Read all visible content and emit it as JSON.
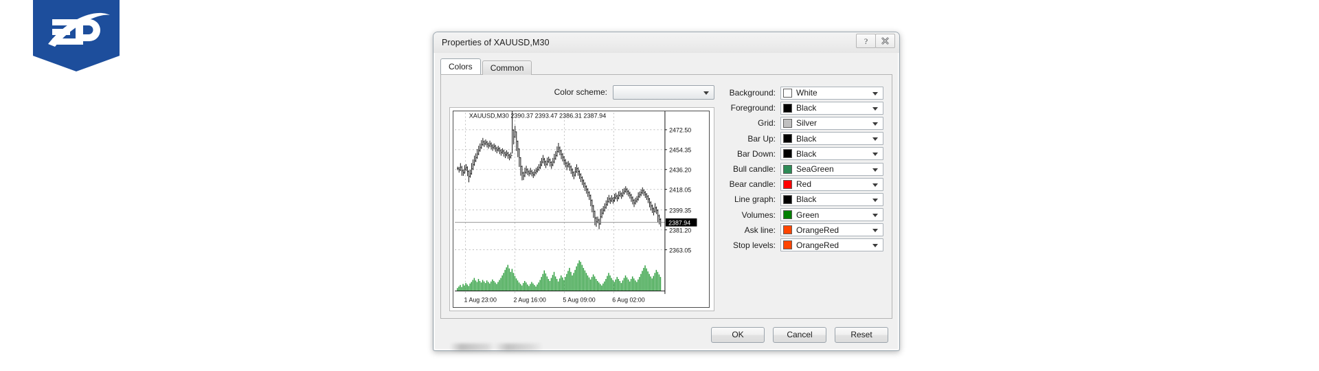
{
  "brand": {
    "name": "fp-logo",
    "text": "FP",
    "color": "#1d4e9c"
  },
  "dialog": {
    "title": "Properties of XAUUSD,M30",
    "title_buttons": [
      {
        "name": "help-button",
        "glyph": "?"
      },
      {
        "name": "close-button",
        "glyph": "✖"
      }
    ],
    "tabs": [
      {
        "label": "Colors",
        "active": true
      },
      {
        "label": "Common",
        "active": false
      }
    ],
    "scheme": {
      "label": "Color scheme:",
      "value": "",
      "placeholder": ""
    },
    "color_rows": [
      {
        "label": "Background:",
        "value": "White",
        "hex": "#ffffff"
      },
      {
        "label": "Foreground:",
        "value": "Black",
        "hex": "#000000"
      },
      {
        "label": "Grid:",
        "value": "Silver",
        "hex": "#c0c0c0"
      },
      {
        "label": "Bar Up:",
        "value": "Black",
        "hex": "#000000"
      },
      {
        "label": "Bar Down:",
        "value": "Black",
        "hex": "#000000"
      },
      {
        "label": "Bull candle:",
        "value": "SeaGreen",
        "hex": "#2e8b57"
      },
      {
        "label": "Bear candle:",
        "value": "Red",
        "hex": "#ff0000"
      },
      {
        "label": "Line graph:",
        "value": "Black",
        "hex": "#000000"
      },
      {
        "label": "Volumes:",
        "value": "Green",
        "hex": "#008000"
      },
      {
        "label": "Ask line:",
        "value": "OrangeRed",
        "hex": "#ff4500"
      },
      {
        "label": "Stop levels:",
        "value": "OrangeRed",
        "hex": "#ff4500"
      }
    ],
    "buttons": [
      {
        "label": "OK",
        "name": "ok-button"
      },
      {
        "label": "Cancel",
        "name": "cancel-button"
      },
      {
        "label": "Reset",
        "name": "reset-button"
      }
    ]
  },
  "chart_data": {
    "type": "line",
    "title": "XAUUSD,M30  2390.37 2393.47 2386.31 2387.94",
    "symbol": "XAUUSD,M30",
    "ohlc": {
      "open": 2390.37,
      "high": 2393.47,
      "low": 2386.31,
      "close": 2387.94
    },
    "xlabel": "",
    "ylabel": "",
    "grid": true,
    "legend": "none",
    "ylim": [
      2356.0,
      2480.0
    ],
    "ytick_labels": [
      "2472.50",
      "2454.35",
      "2436.20",
      "2418.05",
      "2399.35",
      "2381.20",
      "2363.05"
    ],
    "yticks": [
      2472.5,
      2454.35,
      2436.2,
      2418.05,
      2399.35,
      2381.2,
      2363.05
    ],
    "price_marker": {
      "label": "2387.94",
      "value": 2387.94
    },
    "xtick_labels": [
      "1 Aug 23:00",
      "2 Aug 16:00",
      "5 Aug 09:00",
      "6 Aug 02:00"
    ],
    "xticks": [
      0.045,
      0.285,
      0.525,
      0.765
    ],
    "series": [
      {
        "name": "price",
        "style": "ohlc-bars",
        "color": "#000000",
        "values": [
          2437.2,
          2436.0,
          2438.4,
          2435.0,
          2433.4,
          2436.2,
          2438.0,
          2434.6,
          2430.0,
          2432.4,
          2436.8,
          2440.6,
          2444.2,
          2447.0,
          2450.4,
          2453.6,
          2456.2,
          2459.0,
          2461.4,
          2459.8,
          2461.0,
          2459.4,
          2458.0,
          2459.6,
          2457.8,
          2456.2,
          2457.4,
          2455.6,
          2454.0,
          2455.2,
          2453.4,
          2451.8,
          2453.0,
          2451.2,
          2449.6,
          2451.0,
          2449.2,
          2447.6,
          2449.0,
          2472.2,
          2466.0,
          2470.6,
          2462.0,
          2455.0,
          2447.0,
          2439.0,
          2433.0,
          2430.4,
          2433.6,
          2436.0,
          2434.2,
          2432.8,
          2434.6,
          2433.0,
          2431.4,
          2433.2,
          2434.8,
          2436.2,
          2438.0,
          2440.4,
          2443.0,
          2445.6,
          2443.2,
          2441.0,
          2443.4,
          2445.0,
          2442.6,
          2440.4,
          2443.0,
          2446.2,
          2449.0,
          2452.6,
          2456.0,
          2453.2,
          2450.0,
          2447.4,
          2444.6,
          2442.0,
          2439.4,
          2441.0,
          2438.6,
          2436.0,
          2433.4,
          2431.0,
          2434.2,
          2437.0,
          2434.4,
          2431.6,
          2428.8,
          2426.0,
          2423.4,
          2420.6,
          2418.0,
          2415.2,
          2412.4,
          2408.0,
          2403.0,
          2398.0,
          2392.0,
          2388.5,
          2390.2,
          2386.5,
          2393.0,
          2396.4,
          2399.0,
          2401.6,
          2404.2,
          2407.0,
          2409.4,
          2407.8,
          2409.6,
          2408.0,
          2410.4,
          2412.0,
          2410.2,
          2412.6,
          2414.0,
          2412.4,
          2414.8,
          2416.4,
          2418.0,
          2416.2,
          2414.6,
          2412.8,
          2410.4,
          2408.0,
          2405.6,
          2407.4,
          2409.0,
          2411.6,
          2413.2,
          2415.0,
          2416.8,
          2415.2,
          2413.4,
          2411.6,
          2409.2,
          2406.0,
          2403.0,
          2400.4,
          2398.0,
          2401.2,
          2399.0,
          2394.0,
          2390.6,
          2387.94
        ]
      },
      {
        "name": "volume",
        "style": "histogram",
        "color": "#2e9e3e",
        "values": [
          6,
          9,
          12,
          8,
          14,
          11,
          16,
          13,
          10,
          15,
          18,
          22,
          26,
          21,
          18,
          24,
          20,
          17,
          22,
          19,
          16,
          21,
          18,
          15,
          19,
          23,
          20,
          17,
          14,
          18,
          22,
          26,
          31,
          36,
          42,
          47,
          52,
          45,
          38,
          44,
          36,
          30,
          25,
          21,
          17,
          14,
          11,
          16,
          20,
          17,
          13,
          10,
          14,
          18,
          15,
          12,
          9,
          13,
          17,
          22,
          28,
          34,
          41,
          35,
          29,
          24,
          20,
          26,
          32,
          38,
          29,
          24,
          19,
          25,
          31,
          27,
          22,
          28,
          34,
          40,
          46,
          38,
          31,
          36,
          42,
          49,
          55,
          61,
          58,
          52,
          46,
          41,
          36,
          31,
          27,
          23,
          28,
          33,
          29,
          24,
          20,
          17,
          14,
          11,
          15,
          19,
          24,
          30,
          36,
          31,
          26,
          22,
          18,
          23,
          28,
          24,
          20,
          16,
          21,
          26,
          31,
          27,
          23,
          19,
          24,
          29,
          25,
          21,
          18,
          23,
          28,
          34,
          40,
          46,
          51,
          45,
          39,
          34,
          29,
          25,
          30,
          36,
          42,
          38,
          33,
          28
        ]
      }
    ]
  }
}
